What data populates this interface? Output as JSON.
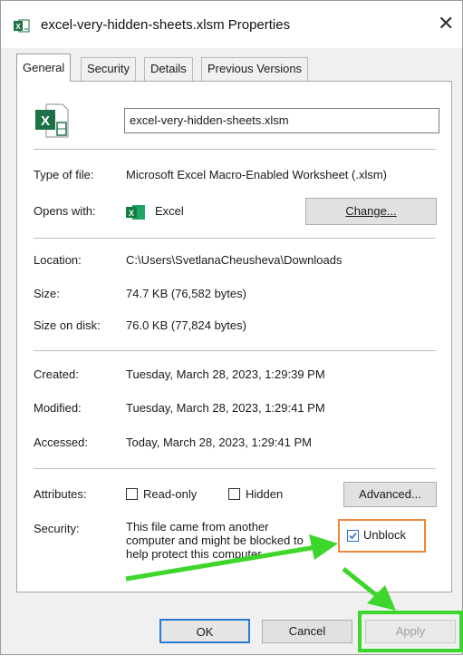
{
  "window": {
    "title": "excel-very-hidden-sheets.xlsm Properties",
    "close_glyph": "✕"
  },
  "tabs": [
    {
      "label": "General",
      "active": true
    },
    {
      "label": "Security",
      "active": false
    },
    {
      "label": "Details",
      "active": false
    },
    {
      "label": "Previous Versions",
      "active": false
    }
  ],
  "file": {
    "name": "excel-very-hidden-sheets.xlsm",
    "icon": "excel-file-icon"
  },
  "rows": {
    "type_label": "Type of file:",
    "type_value": "Microsoft Excel Macro-Enabled Worksheet (.xlsm)",
    "opens_label": "Opens with:",
    "opens_value": "Excel",
    "change_button": "Change...",
    "location_label": "Location:",
    "location_value": "C:\\Users\\SvetlanaCheusheva\\Downloads",
    "size_label": "Size:",
    "size_value": "74.7 KB (76,582 bytes)",
    "size_on_disk_label": "Size on disk:",
    "size_on_disk_value": "76.0 KB (77,824 bytes)",
    "created_label": "Created:",
    "created_value": "Tuesday, March 28, 2023, 1:29:39 PM",
    "modified_label": "Modified:",
    "modified_value": "Tuesday, March 28, 2023, 1:29:41 PM",
    "accessed_label": "Accessed:",
    "accessed_value": "Today, March 28, 2023, 1:29:41 PM"
  },
  "attributes": {
    "label": "Attributes:",
    "readonly": {
      "label": "Read-only",
      "checked": false
    },
    "hidden": {
      "label": "Hidden",
      "checked": false
    },
    "advanced_button": "Advanced..."
  },
  "security": {
    "label": "Security:",
    "text_line1": "This file came from another",
    "text_line2": "computer and might be blocked to",
    "text_line3": "help protect this computer.",
    "unblock": {
      "label": "Unblock",
      "checked": true
    }
  },
  "buttons": {
    "ok": "OK",
    "cancel": "Cancel",
    "apply": "Apply",
    "apply_enabled": false
  },
  "annotation_colors": {
    "arrow": "#3dd62b",
    "highlight_box": "#3dd62b",
    "unblock_box": "#f0883a"
  }
}
